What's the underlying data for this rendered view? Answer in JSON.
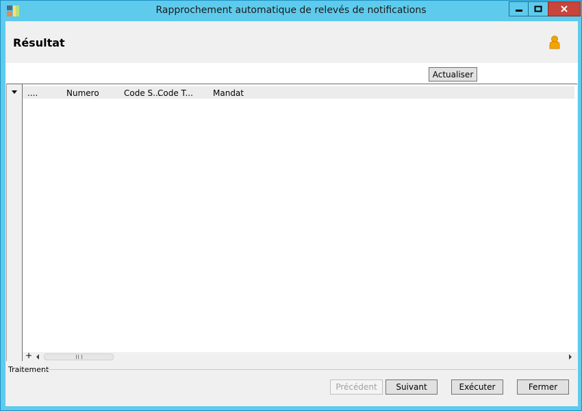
{
  "window": {
    "title": "Rapprochement automatique de relevés de notifications",
    "icons": {
      "app": "app-icon",
      "minimize": "minimize-icon",
      "maximize": "maximize-icon",
      "close": "close-icon"
    },
    "colors": {
      "titlebar": "#5ecbec",
      "close_button": "#c7453a"
    }
  },
  "header": {
    "title": "Résultat",
    "user_icon": "user-icon",
    "user_icon_color": "#f2a500"
  },
  "toolbar": {
    "refresh_label": "Actualiser"
  },
  "grid": {
    "columns": [
      "....",
      "Numero",
      "Code S...",
      "Code T...",
      "Mandat"
    ],
    "rows": [],
    "add_label": "+",
    "icons": {
      "expand": "expand-arrow-icon",
      "scroll_left": "scroll-left-icon",
      "scroll_right": "scroll-right-icon"
    }
  },
  "process_group": {
    "label": "Traitement"
  },
  "footer": {
    "previous_label": "Précédent",
    "previous_enabled": false,
    "next_label": "Suivant",
    "execute_label": "Exécuter",
    "close_label": "Fermer"
  }
}
